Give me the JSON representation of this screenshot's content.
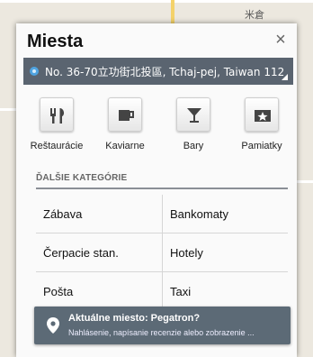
{
  "map": {
    "labels": [
      "米倉"
    ]
  },
  "dialog": {
    "title": "Miesta",
    "close_glyph": "×",
    "location": "No. 36-70立功街北投區, Tchaj-pej, Taiwan 112",
    "categories": [
      {
        "label": "Reštaurácie",
        "icon": "fork-knife-icon"
      },
      {
        "label": "Kaviarne",
        "icon": "coffee-cup-icon"
      },
      {
        "label": "Bary",
        "icon": "cocktail-glass-icon"
      },
      {
        "label": "Pamiatky",
        "icon": "star-ticket-icon"
      }
    ],
    "more_header": "ĎALŠIE KATEGÓRIE",
    "more_categories": [
      [
        "Zábava",
        "Bankomaty"
      ],
      [
        "Čerpacie stan.",
        "Hotely"
      ],
      [
        "Pošta",
        "Taxi"
      ]
    ]
  },
  "toast": {
    "title": "Aktuálne miesto: Pegatron?",
    "subtitle": "Nahlásenie, napísanie recenzie alebo zobrazenie ..."
  }
}
